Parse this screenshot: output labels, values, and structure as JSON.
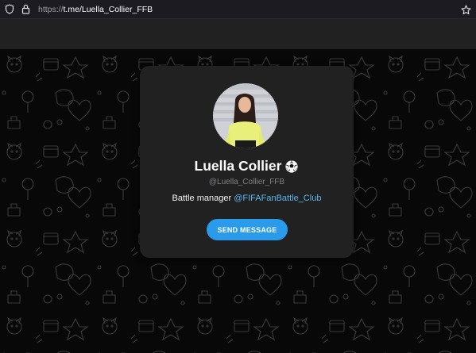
{
  "browser": {
    "url_prefix": "https://",
    "url_host": "t.me",
    "url_path": "/Luella_Collier_FFB"
  },
  "profile": {
    "name": "Luella Collier",
    "emoji": "soccer-ball-icon",
    "username": "@Luella_Collier_FFB",
    "bio_text": "Battle manager",
    "bio_link": "@FIFAFanBattle_Club",
    "send_button": "SEND MESSAGE"
  },
  "colors": {
    "accent": "#2a9bea",
    "link": "#5bb5ee",
    "card": "#212121",
    "background": "#080808"
  }
}
